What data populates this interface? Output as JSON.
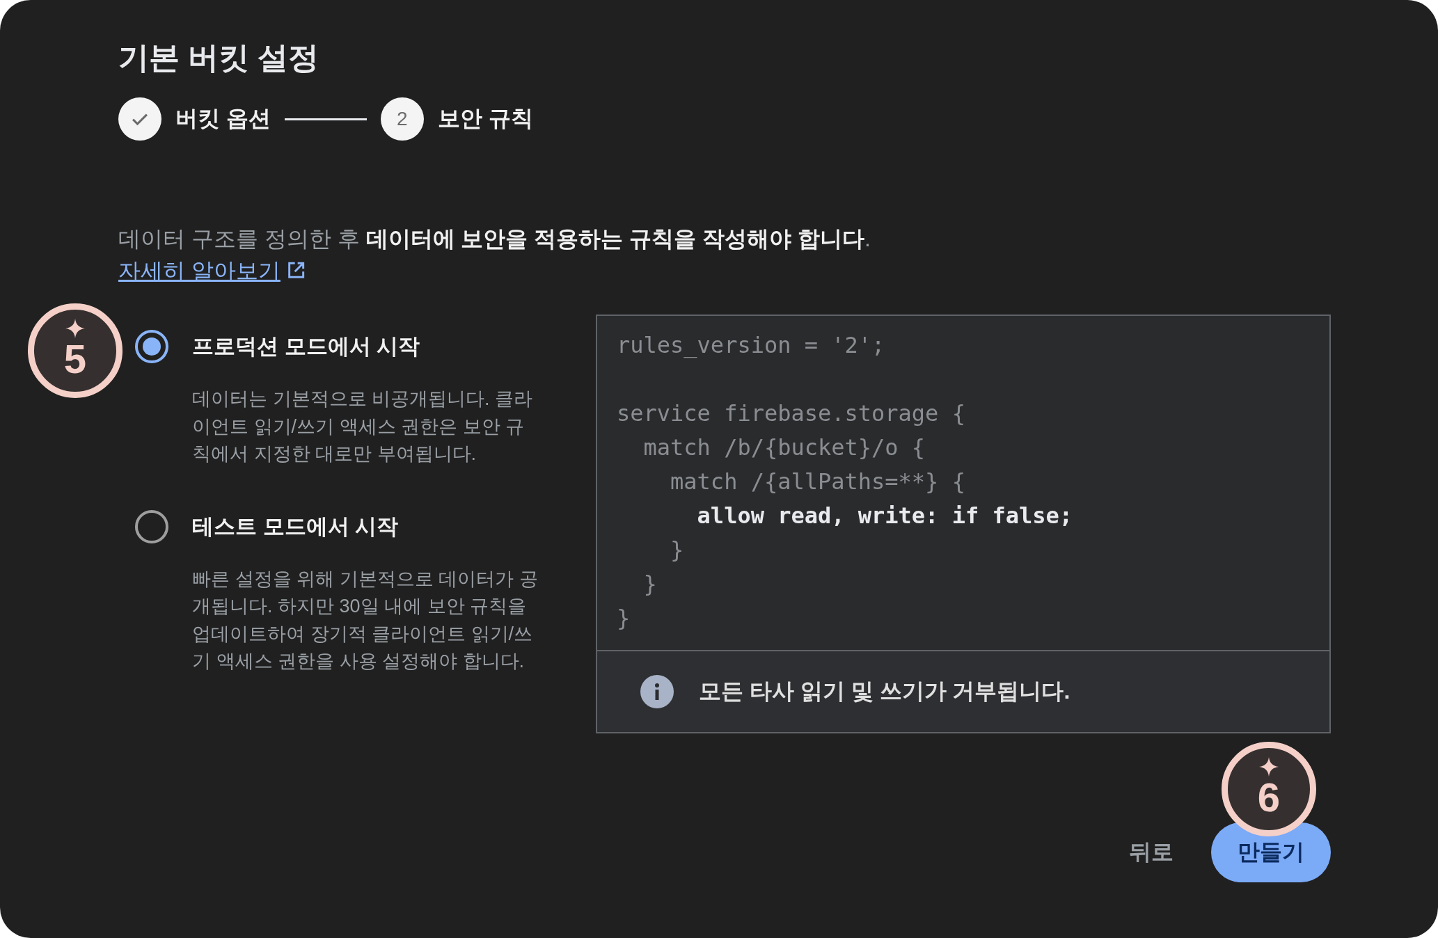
{
  "dialog": {
    "title": "기본 버킷 설정"
  },
  "stepper": {
    "steps": [
      {
        "label": "버킷 옵션",
        "completed": true
      },
      {
        "number": "2",
        "label": "보안 규칙",
        "completed": false
      }
    ]
  },
  "intro": {
    "text": "데이터 구조를 정의한 후 **데이터에 보안을 적용하는 규칙을 작성해야 합니다**.",
    "link": "자세히 알아보기"
  },
  "options": [
    {
      "label": "프로덕션 모드에서 시작",
      "description": "데이터는 기본적으로 비공개됩니다. 클라이언트 읽기/쓰기 액세스 권한은 보안 규칙에서 지정한 대로만 부여됩니다.",
      "selected": true
    },
    {
      "label": "테스트 모드에서 시작",
      "description": "빠른 설정을 위해 기본적으로 데이터가 공개됩니다. 하지만 30일 내에 보안 규칙을 업데이트하여 장기적 클라이언트 읽기/쓰기 액세스 권한을 사용 설정해야 합니다.",
      "selected": false
    }
  ],
  "rules": {
    "code_blocks": [
      {
        "lines": [
          {
            "text": "rules_version = '2';",
            "emphasis": false
          }
        ]
      },
      {
        "lines": [
          {
            "text": "service firebase.storage {",
            "emphasis": false
          },
          {
            "text": "  match /b/{bucket}/o {",
            "emphasis": false
          },
          {
            "text": "    match /{allPaths=**} {",
            "emphasis": false
          },
          {
            "text": "      allow read, write: if false;",
            "emphasis": true
          },
          {
            "text": "    }",
            "emphasis": false
          },
          {
            "text": "  }",
            "emphasis": false
          },
          {
            "text": "}",
            "emphasis": false
          }
        ]
      }
    ],
    "notice": "모든 타사 읽기 및 쓰기가 거부됩니다."
  },
  "buttons": [
    {
      "label": "뒤로",
      "kind": "text"
    },
    {
      "label": "만들기",
      "kind": "filled"
    }
  ],
  "callouts": [
    {
      "number": "5"
    },
    {
      "number": "6"
    }
  ]
}
